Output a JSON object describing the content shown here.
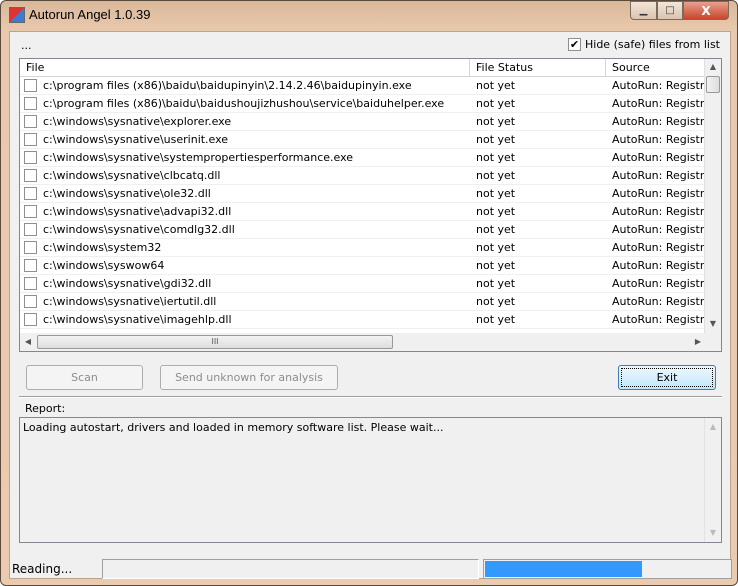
{
  "window": {
    "title": "Autorun Angel 1.0.39",
    "close_label": "X"
  },
  "top": {
    "dots": "...",
    "hide_label": "Hide (safe) files from list",
    "hide_checked": true
  },
  "list": {
    "columns": [
      "File",
      "File Status",
      "Source"
    ],
    "rows": [
      {
        "file": "c:\\program files (x86)\\baidu\\baidupinyin\\2.14.2.46\\baidupinyin.exe",
        "status": "not yet",
        "source": "AutoRun: Registry"
      },
      {
        "file": "c:\\program files (x86)\\baidu\\baidushoujizhushou\\service\\baiduhelper.exe",
        "status": "not yet",
        "source": "AutoRun: Registry"
      },
      {
        "file": "c:\\windows\\sysnative\\explorer.exe",
        "status": "not yet",
        "source": "AutoRun: Registry"
      },
      {
        "file": "c:\\windows\\sysnative\\userinit.exe",
        "status": "not yet",
        "source": "AutoRun: Registry"
      },
      {
        "file": "c:\\windows\\sysnative\\systempropertiesperformance.exe",
        "status": "not yet",
        "source": "AutoRun: Registry"
      },
      {
        "file": "c:\\windows\\sysnative\\clbcatq.dll",
        "status": "not yet",
        "source": "AutoRun: Registry"
      },
      {
        "file": "c:\\windows\\sysnative\\ole32.dll",
        "status": "not yet",
        "source": "AutoRun: Registry"
      },
      {
        "file": "c:\\windows\\sysnative\\advapi32.dll",
        "status": "not yet",
        "source": "AutoRun: Registry"
      },
      {
        "file": "c:\\windows\\sysnative\\comdlg32.dll",
        "status": "not yet",
        "source": "AutoRun: Registry"
      },
      {
        "file": "c:\\windows\\system32",
        "status": "not yet",
        "source": "AutoRun: Registry"
      },
      {
        "file": "c:\\windows\\syswow64",
        "status": "not yet",
        "source": "AutoRun: Registry"
      },
      {
        "file": "c:\\windows\\sysnative\\gdi32.dll",
        "status": "not yet",
        "source": "AutoRun: Registry"
      },
      {
        "file": "c:\\windows\\sysnative\\iertutil.dll",
        "status": "not yet",
        "source": "AutoRun: Registry"
      },
      {
        "file": "c:\\windows\\sysnative\\imagehlp.dll",
        "status": "not yet",
        "source": "AutoRun: Registry"
      }
    ]
  },
  "buttons": {
    "scan": "Scan",
    "send": "Send unknown for analysis",
    "exit": "Exit"
  },
  "report": {
    "label": "Report:",
    "text": "Loading autostart, drivers and loaded in memory software list. Please wait..."
  },
  "statusbar": {
    "text": "Reading...",
    "progress_percent": 64,
    "progress_color": "#3399ff"
  }
}
